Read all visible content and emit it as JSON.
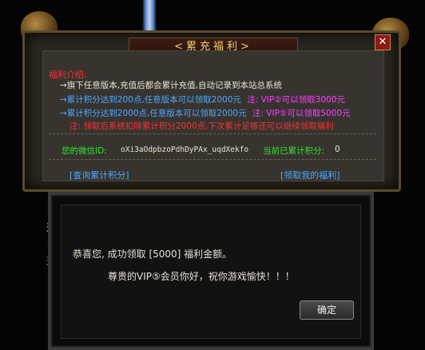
{
  "panel": {
    "title": "<累充福利>",
    "close": "✕",
    "intro_label": "福利介绍:",
    "lines": [
      {
        "text": "→旗下任意版本,充值后都会累计充值,自动记录到本站总系统",
        "color": "#e8e4d0"
      },
      {
        "text": "→累计积分达到200点,任意版本可以领取2000元",
        "color": "#4ea8ff",
        "note": "注: VIP②可以领取3000元",
        "note_color": "#ff40ff"
      },
      {
        "text": "→累计积分达到2000点,任意版本可以领取2000元",
        "color": "#4ea8ff",
        "note": "注: VIP⑤可以领取5000元",
        "note_color": "#ff40ff"
      },
      {
        "text": "注: 领取后系统扣除累计积分2000点,下次累计足够还可以继续领取福利",
        "color": "#ff3030"
      }
    ],
    "wechat_label": "您的微信ID:",
    "wechat_id": "oXi3aOdpbzoPdhDyPAx_uqdXekfo",
    "points_label": "当前已累计积分:",
    "points_value": "0",
    "query_button": "[查询累计积分]",
    "claim_button": "[领取我的福利]"
  },
  "dialog": {
    "message1": "恭喜您, 成功领取 [5000] 福利金额。",
    "message2": "尊贵的VIP⑤会员你好，祝你游戏愉快！！！",
    "ok_button": "确定"
  },
  "side_texts": [
    "逛",
    "逛"
  ],
  "colors": {
    "accent_gold": "#f0d070",
    "label_green": "#2ee82e",
    "link_blue": "#4ea8ff",
    "warn_red": "#ff3030",
    "vip_magenta": "#ff40ff"
  }
}
